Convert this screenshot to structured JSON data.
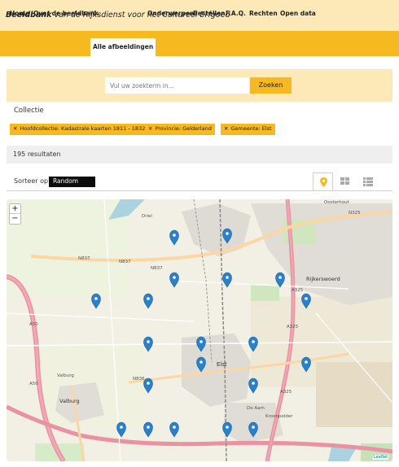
{
  "header": {
    "brand_bold": "Beeldbank",
    "brand_rest": " van de Rijksdienst voor het ",
    "brand_italic": "Cultureel Erfgoed"
  },
  "nav": {
    "items": [
      "Home",
      "Over de beeldbank",
      "Alle afbeeldingen",
      "Onderwerpen",
      "Bestellen",
      "F.A.Q.",
      "Rechten",
      "Open data"
    ],
    "active": "Alle afbeeldingen"
  },
  "search": {
    "placeholder": "Vul uw zoekterm in...",
    "button_label": "Zoeken"
  },
  "facets": {
    "title": "Collectie",
    "chips": [
      "Hoofdcollectie: Kadastrale kaarten 1811 - 1832",
      "Provincie: Gelderland",
      "Gemeente: Elst"
    ]
  },
  "results": {
    "text": "195 resultaten"
  },
  "sort": {
    "label": "Sorteer op",
    "value": "Random"
  },
  "view_options": [
    "map-pin-icon",
    "grid-icon",
    "list-icon"
  ],
  "map": {
    "labels": [
      "Driel",
      "N837",
      "N837",
      "N837",
      "Elst",
      "Rijkerswoerd",
      "A325",
      "A325",
      "A325",
      "N325",
      "A50",
      "A50",
      "Valburg",
      "Valburg",
      "N836",
      "Oosterhout",
      "De Aam",
      "Kroonpolder",
      "Leaflet"
    ],
    "marker_count": 22,
    "zoom_in": "+",
    "zoom_out": "−",
    "attribution": "Leaflet"
  },
  "colors": {
    "header_bg": "#fde9b8",
    "accent": "#f7b920",
    "marker": "#2a81cb"
  }
}
